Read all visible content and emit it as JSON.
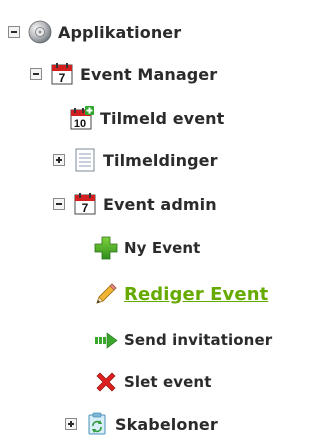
{
  "tree": {
    "root": {
      "label": "Applikationer",
      "icon": "app-disc-icon",
      "toggle": "collapse"
    },
    "event_manager": {
      "label": "Event Manager",
      "icon": "calendar-7-icon",
      "toggle": "collapse"
    },
    "tilmeld_event": {
      "label": "Tilmeld event",
      "icon": "calendar-10-plus-icon"
    },
    "tilmeldinger": {
      "label": "Tilmeldinger",
      "icon": "list-icon",
      "toggle": "expand"
    },
    "event_admin": {
      "label": "Event admin",
      "icon": "calendar-7-icon",
      "toggle": "collapse"
    },
    "ny_event": {
      "label": "Ny Event",
      "icon": "green-plus-icon"
    },
    "rediger_event": {
      "label": "Rediger Event",
      "icon": "pencil-icon",
      "active": true
    },
    "send_invitationer": {
      "label": "Send invitationer",
      "icon": "green-arrow-icon"
    },
    "slet_event": {
      "label": "Slet event",
      "icon": "red-x-icon"
    },
    "skabeloner": {
      "label": "Skabeloner",
      "icon": "clipboard-refresh-icon",
      "toggle": "expand"
    }
  },
  "colors": {
    "active_link": "#66aa00",
    "text": "#2b2b2b",
    "toggle_border": "#8a8a8a"
  }
}
